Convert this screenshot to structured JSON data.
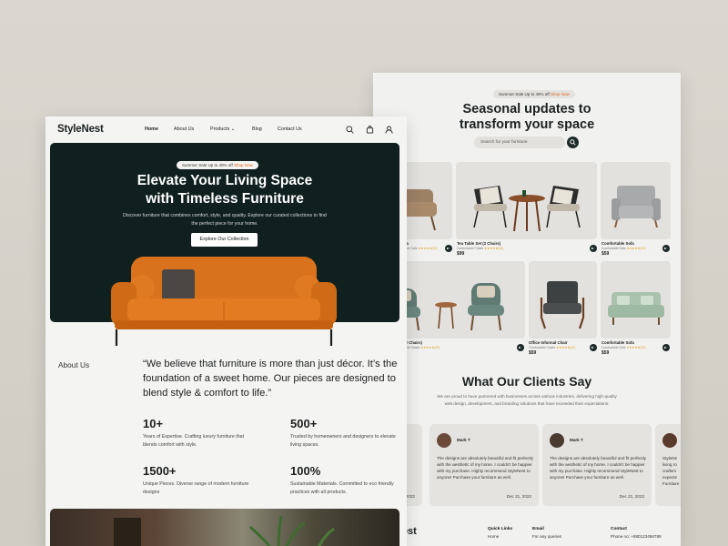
{
  "back": {
    "promo": {
      "text": "Summer Sale Up to 40% off",
      "link": "Shop Now"
    },
    "title_line1": "Seasonal updates to",
    "title_line2": "transform your space",
    "search_placeholder": "Search for your furniture",
    "products": [
      {
        "name": "ide Sofa",
        "sub": "Comfortable Sofa",
        "rating": "★★★★★(12)",
        "price": ""
      },
      {
        "name": "Tea Table Set (2 Chairs)",
        "sub": "Comfortable Chairs",
        "rating": "★★★★★(12)",
        "price": "$99"
      },
      {
        "name": "Comfortable Sofa",
        "sub": "Comfortable Sofa",
        "rating": "★★★★★(12)",
        "price": "$59"
      },
      {
        "name": "Table (2 Chairs)",
        "sub": "Comfortable Chairs",
        "rating": "★★★★★(12)",
        "price": ""
      },
      {
        "name": "Office Informal Chair",
        "sub": "Comfortable Chairs",
        "rating": "★★★★★(12)",
        "price": "$59"
      },
      {
        "name": "Comfortable Sofa",
        "sub": "Comfortable Sofa",
        "rating": "★★★★★(12)",
        "price": "$59"
      }
    ],
    "clients_title": "What Our Clients Say",
    "clients_desc": "We are proud to have partnered with businesses across various industries, delivering high-quality web design, development, and branding solutions that have exceeded their expectations.",
    "testimonials": [
      {
        "name": "",
        "text": "ce.",
        "date": "2022"
      },
      {
        "name": "Mark T",
        "text": "The designs are absolutely beautiful and fit perfectly with the aesthetic of my home. I couldn't be happier with my purchase. Highly recommend StyleNest to anyone! Purchase your furniture as well.",
        "date": "Dec 21, 2022"
      },
      {
        "name": "Mark T",
        "text": "The designs are absolutely beautiful and fit perfectly with the aesthetic of my home. I couldn't be happier with my purchase. Highly recommend StyleNest to anyone! Purchase your furniture as well.",
        "date": "Dec 21, 2022"
      },
      {
        "name": "",
        "text": "StyleNe living ro craftsm expecte Furniture",
        "date": ""
      }
    ],
    "footer": {
      "brand": "Nest",
      "col1": {
        "title": "Quick Links",
        "item": "Home"
      },
      "col2": {
        "title": "Email",
        "item": "For any queries"
      },
      "col3": {
        "title": "Contact",
        "item": "Phone no: +880123456789"
      }
    }
  },
  "front": {
    "brand": "StyleNest",
    "nav": [
      "Home",
      "About Us",
      "Products",
      "Blog",
      "Contact Us"
    ],
    "hero": {
      "promo": {
        "text": "Summer Sale Up to 40% off",
        "link": "Shop Now"
      },
      "title_line1": "Elevate Your Living Space",
      "title_line2": "with Timeless Furniture",
      "desc": "Discover furniture that combines comfort, style, and quality. Explore our curated collections to find the perfect piece for your home.",
      "button": "Explore Our Collection"
    },
    "about_label": "About Us",
    "quote": "“We believe that furniture is more than just décor. It’s the foundation of a sweet home. Our pieces are designed to blend style & comfort to life.”",
    "stats": [
      {
        "num": "10+",
        "text": "Years of Expertise. Crafting luxury furniture that blends comfort with style."
      },
      {
        "num": "500+",
        "text": "Trusted by homeowners and designers to elevate living spaces."
      },
      {
        "num": "1500+",
        "text": "Unique Pieces. Diverse range of modern furniture designs"
      },
      {
        "num": "100%",
        "text": "Sustainable Materials. Committed to eco friendly practices with all products."
      }
    ]
  },
  "colors": {
    "accent": "#e0661b",
    "dark": "#10201f",
    "sofa": "#d9721c"
  }
}
